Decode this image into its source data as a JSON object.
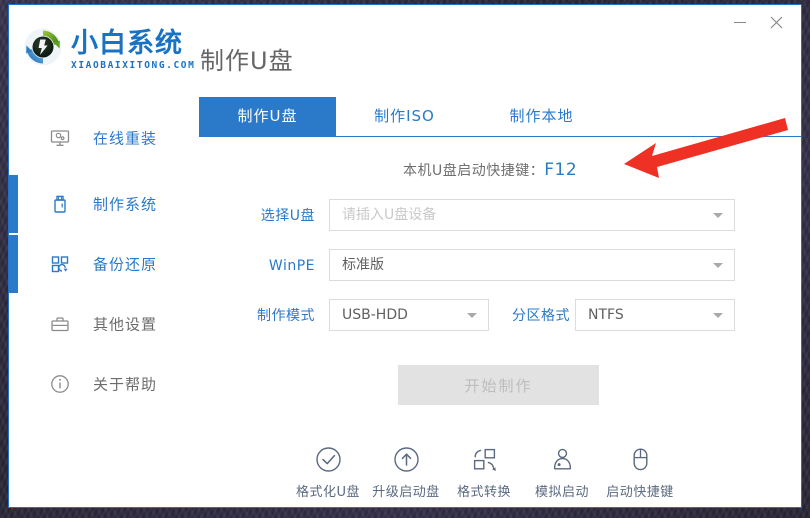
{
  "brand": {
    "name_cn": "小白系统",
    "name_en": "XIAOBAIXITONG.COM",
    "logo_icon": "refresh-circle-logo-icon"
  },
  "header": {
    "title": "制作U盘",
    "minimize_icon": "minimize-icon",
    "close_icon": "close-icon"
  },
  "sidebar": {
    "items": [
      {
        "label": "在线重装",
        "icon": "monitor-icon",
        "active": false,
        "accent": false
      },
      {
        "label": "制作系统",
        "icon": "usb-drive-icon",
        "active": true,
        "accent": true
      },
      {
        "label": "备份还原",
        "icon": "backup-restore-icon",
        "active": true,
        "accent": true
      },
      {
        "label": "其他设置",
        "icon": "briefcase-icon",
        "active": false,
        "accent": false
      },
      {
        "label": "关于帮助",
        "icon": "info-circle-icon",
        "active": false,
        "accent": false
      }
    ]
  },
  "main": {
    "tabs": [
      {
        "label": "制作U盘",
        "active": true
      },
      {
        "label": "制作ISO",
        "active": false
      },
      {
        "label": "制作本地",
        "active": false
      }
    ],
    "hint": {
      "text": "本机U盘启动快捷键：",
      "key": "F12"
    },
    "fields": [
      {
        "label": "选择U盘",
        "value": "",
        "placeholder": "请插入U盘设备",
        "caret_icon": "chevron-down-icon"
      },
      {
        "label": "WinPE",
        "value": "标准版",
        "placeholder": "",
        "caret_icon": "chevron-down-icon"
      },
      {
        "label": "制作模式",
        "value": "USB-HDD",
        "placeholder": "",
        "caret_icon": "chevron-down-icon"
      },
      {
        "label": "分区格式",
        "value": "NTFS",
        "placeholder": "",
        "caret_icon": "chevron-down-icon"
      }
    ],
    "start_button": {
      "label": "开始制作",
      "disabled": true
    },
    "tools": [
      {
        "label": "格式化U盘",
        "icon": "check-circle-icon"
      },
      {
        "label": "升级启动盘",
        "icon": "arrow-up-circle-icon"
      },
      {
        "label": "格式转换",
        "icon": "format-convert-icon"
      },
      {
        "label": "模拟启动",
        "icon": "simulate-boot-icon"
      },
      {
        "label": "启动快捷键",
        "icon": "mouse-icon"
      }
    ]
  },
  "annotation": {
    "arrow_icon": "red-arrow-pointing-left",
    "color": "#ee3124"
  },
  "colors": {
    "accent": "#2a7ac9",
    "muted_text": "#6b6b6b",
    "disabled_bg": "#e2e2e2"
  }
}
